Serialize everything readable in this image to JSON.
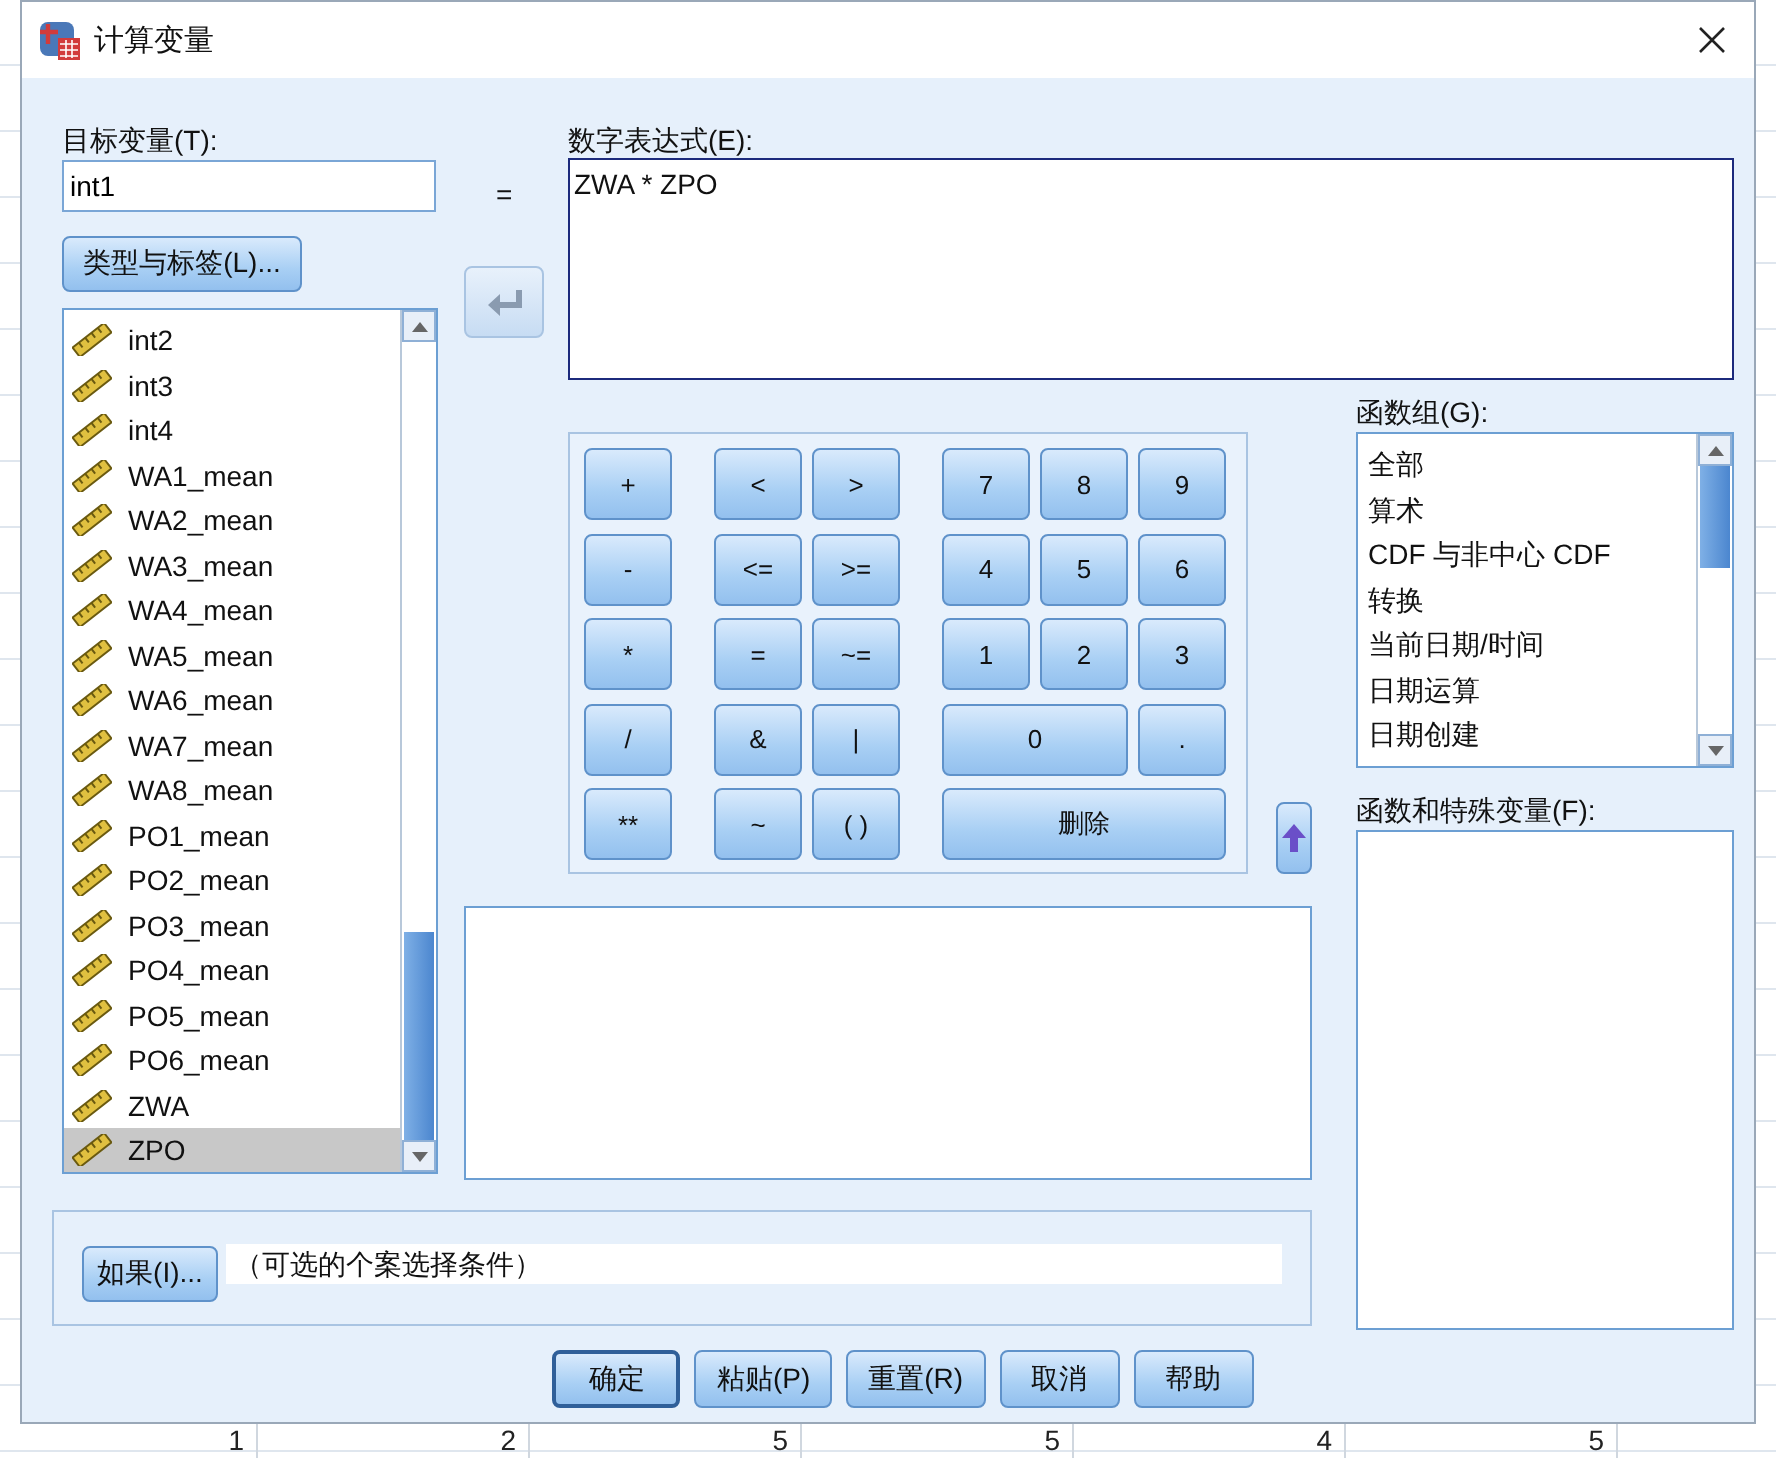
{
  "window": {
    "title": "计算变量"
  },
  "target": {
    "label": "目标变量(T):",
    "value": "int1",
    "type_button": "类型与标签(L)..."
  },
  "equals": "=",
  "variables": [
    {
      "name": "int2",
      "selected": false
    },
    {
      "name": "int3",
      "selected": false
    },
    {
      "name": "int4",
      "selected": false
    },
    {
      "name": "WA1_mean",
      "selected": false
    },
    {
      "name": "WA2_mean",
      "selected": false
    },
    {
      "name": "WA3_mean",
      "selected": false
    },
    {
      "name": "WA4_mean",
      "selected": false
    },
    {
      "name": "WA5_mean",
      "selected": false
    },
    {
      "name": "WA6_mean",
      "selected": false
    },
    {
      "name": "WA7_mean",
      "selected": false
    },
    {
      "name": "WA8_mean",
      "selected": false
    },
    {
      "name": "PO1_mean",
      "selected": false
    },
    {
      "name": "PO2_mean",
      "selected": false
    },
    {
      "name": "PO3_mean",
      "selected": false
    },
    {
      "name": "PO4_mean",
      "selected": false
    },
    {
      "name": "PO5_mean",
      "selected": false
    },
    {
      "name": "PO6_mean",
      "selected": false
    },
    {
      "name": "ZWA",
      "selected": false
    },
    {
      "name": "ZPO",
      "selected": true
    }
  ],
  "expression": {
    "label": "数字表达式(E):",
    "value": "ZWA * ZPO"
  },
  "keypad": [
    {
      "op": "+",
      "compare": [
        "<",
        ">"
      ],
      "digits": [
        "7",
        "8",
        "9"
      ]
    },
    {
      "op": "-",
      "compare": [
        "<=",
        ">="
      ],
      "digits": [
        "4",
        "5",
        "6"
      ]
    },
    {
      "op": "*",
      "compare": [
        "=",
        "~="
      ],
      "digits": [
        "1",
        "2",
        "3"
      ]
    },
    {
      "op": "/",
      "compare": [
        "&",
        "|"
      ],
      "digits": [
        "0",
        "."
      ]
    },
    {
      "op": "**",
      "compare": [
        "~",
        "( )"
      ],
      "digits": [
        "删除"
      ]
    }
  ],
  "function_groups": {
    "label": "函数组(G):",
    "items": [
      {
        "name": "全部",
        "selected": false
      },
      {
        "name": "算术",
        "selected": false
      },
      {
        "name": "CDF 与非中心 CDF",
        "selected": false
      },
      {
        "name": "转换",
        "selected": false
      },
      {
        "name": "当前日期/时间",
        "selected": false
      },
      {
        "name": "日期运算",
        "selected": false
      },
      {
        "name": "日期创建",
        "selected": false
      }
    ]
  },
  "functions": {
    "label": "函数和特殊变量(F):"
  },
  "condition": {
    "button": "如果(I)...",
    "text": "（可选的个案选择条件）"
  },
  "buttons": [
    {
      "label": "确定",
      "default": true
    },
    {
      "label": "粘贴(P)",
      "default": false
    },
    {
      "label": "重置(R)",
      "default": false
    },
    {
      "label": "取消",
      "default": false
    },
    {
      "label": "帮助",
      "default": false
    }
  ],
  "background_cells": [
    "1",
    "2",
    "5",
    "5",
    "4",
    "5"
  ]
}
